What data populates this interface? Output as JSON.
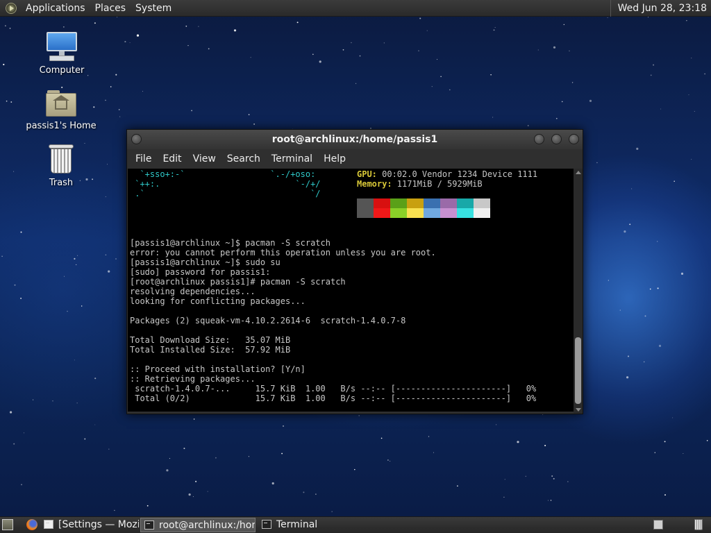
{
  "top_panel": {
    "menus": [
      "Applications",
      "Places",
      "System"
    ],
    "clock": "Wed Jun 28, 23:18"
  },
  "desktop": {
    "icons": [
      {
        "label": "Computer",
        "icon": "computer-icon"
      },
      {
        "label": "passis1's Home",
        "icon": "home-folder-icon"
      },
      {
        "label": "Trash",
        "icon": "trash-icon"
      }
    ]
  },
  "terminal": {
    "title": "root@archlinux:/home/passis1",
    "menu": [
      "File",
      "Edit",
      "View",
      "Search",
      "Terminal",
      "Help"
    ],
    "logo_lines": [
      "  `+sso+:-`                 `.-/+oso:",
      " `++:.                           `-/+/",
      " .`                                 `/"
    ],
    "sysinfo": [
      {
        "key": "GPU:",
        "value": " 00:02.0 Vendor 1234 Device 1111"
      },
      {
        "key": "Memory:",
        "value": " 1171MiB / 5929MiB"
      }
    ],
    "palette_top": [
      "#555555",
      "#d81010",
      "#5aa018",
      "#c8a010",
      "#3a70b0",
      "#9a6aa8",
      "#18a8a8",
      "#c8c8c8"
    ],
    "palette_bottom": [
      "#555555",
      "#f01818",
      "#8ad028",
      "#f8e050",
      "#70a8e0",
      "#c890d0",
      "#38e0e0",
      "#f0f0f0"
    ],
    "lines": [
      "[passis1@archlinux ~]$ pacman -S scratch",
      "error: you cannot perform this operation unless you are root.",
      "[passis1@archlinux ~]$ sudo su",
      "[sudo] password for passis1:",
      "[root@archlinux passis1]# pacman -S scratch",
      "resolving dependencies...",
      "looking for conflicting packages...",
      "",
      "Packages (2) squeak-vm-4.10.2.2614-6  scratch-1.4.0.7-8",
      "",
      "Total Download Size:   35.07 MiB",
      "Total Installed Size:  57.92 MiB",
      "",
      ":: Proceed with installation? [Y/n]",
      ":: Retrieving packages...",
      " scratch-1.4.0.7-...     15.7 KiB  1.00   B/s --:-- [----------------------]   0%",
      " Total (0/2)             15.7 KiB  1.00   B/s --:-- [----------------------]   0%"
    ]
  },
  "taskbar": {
    "tasks": [
      {
        "label": "[Settings — Mozilla Fi...",
        "active": false
      },
      {
        "label": "root@archlinux:/hom...",
        "active": true
      },
      {
        "label": "Terminal",
        "active": false
      }
    ]
  }
}
